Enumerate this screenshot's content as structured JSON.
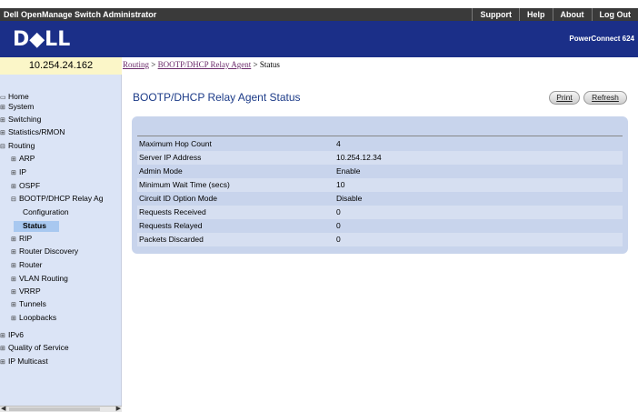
{
  "header": {
    "app_title": "Dell OpenManage Switch Administrator",
    "links": [
      "Support",
      "Help",
      "About",
      "Log Out"
    ]
  },
  "brand": {
    "logo": "D◆LL",
    "model": "PowerConnect 624"
  },
  "sidebar": {
    "ip_address": "10.254.24.162",
    "items": [
      {
        "label": "Home",
        "icon": "home-icon",
        "selected": false
      },
      {
        "label": "System",
        "icon": "plus-icon",
        "selected": false
      },
      {
        "label": "Switching",
        "icon": "plus-icon",
        "selected": false
      },
      {
        "label": "Statistics/RMON",
        "icon": "plus-icon",
        "selected": false
      },
      {
        "label": "Routing",
        "icon": "minus-icon",
        "selected": false
      },
      {
        "label": "ARP",
        "icon": "plus-icon",
        "selected": false
      },
      {
        "label": "IP",
        "icon": "plus-icon",
        "selected": false
      },
      {
        "label": "OSPF",
        "icon": "plus-icon",
        "selected": false
      },
      {
        "label": "BOOTP/DHCP Relay Ag",
        "icon": "minus-icon",
        "selected": false
      },
      {
        "label": "Configuration",
        "icon": "",
        "selected": false
      },
      {
        "label": "Status",
        "icon": "",
        "selected": true
      },
      {
        "label": "RIP",
        "icon": "plus-icon",
        "selected": false
      },
      {
        "label": "Router Discovery",
        "icon": "plus-icon",
        "selected": false
      },
      {
        "label": "Router",
        "icon": "plus-icon",
        "selected": false
      },
      {
        "label": "VLAN Routing",
        "icon": "plus-icon",
        "selected": false
      },
      {
        "label": "VRRP",
        "icon": "plus-icon",
        "selected": false
      },
      {
        "label": "Tunnels",
        "icon": "plus-icon",
        "selected": false
      },
      {
        "label": "Loopbacks",
        "icon": "plus-icon",
        "selected": false
      },
      {
        "label": "IPv6",
        "icon": "plus-icon",
        "selected": false
      },
      {
        "label": "Quality of Service",
        "icon": "plus-icon",
        "selected": false
      },
      {
        "label": "IP Multicast",
        "icon": "plus-icon",
        "selected": false
      }
    ]
  },
  "breadcrumb": {
    "routing": "Routing",
    "sep1": " > ",
    "relay": "BOOTP/DHCP Relay Agent",
    "sep2": " > ",
    "current": "Status"
  },
  "main": {
    "title": "BOOTP/DHCP Relay Agent Status",
    "print_label": "Print",
    "refresh_label": "Refresh",
    "rows": [
      {
        "label": "Maximum Hop Count",
        "value": "4"
      },
      {
        "label": "Server IP Address",
        "value": "10.254.12.34"
      },
      {
        "label": "Admin Mode",
        "value": "Enable"
      },
      {
        "label": "Minimum Wait Time (secs)",
        "value": "10"
      },
      {
        "label": "Circuit ID Option Mode",
        "value": "Disable"
      },
      {
        "label": "Requests Received",
        "value": "0"
      },
      {
        "label": "Requests Relayed",
        "value": "0"
      },
      {
        "label": "Packets Discarded",
        "value": "0"
      }
    ]
  },
  "colors": {
    "brand_blue": "#1b2f88",
    "title_blue": "#1c3b88",
    "sidebar_bg": "#dbe4f6",
    "ip_box_bg": "#fbf6c8",
    "panel_bg": "#c8d4ec"
  }
}
